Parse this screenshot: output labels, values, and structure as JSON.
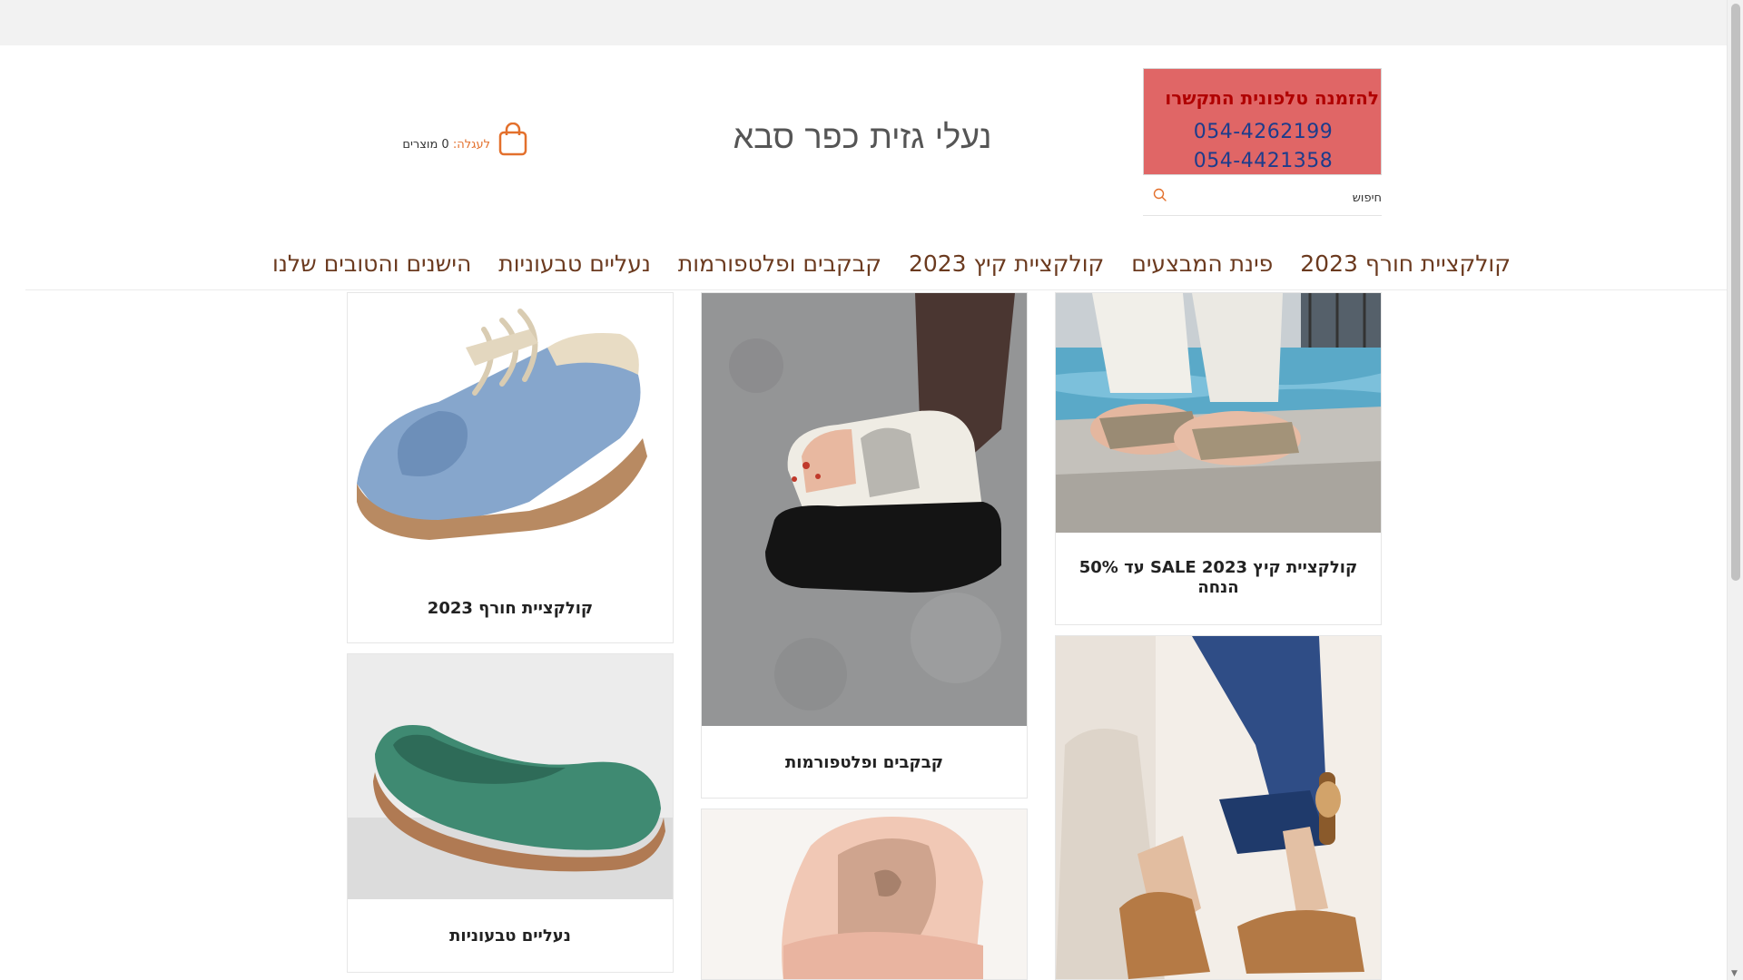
{
  "header": {
    "site_title": "נעלי גזית כפר סבא",
    "phone_banner": {
      "heading": "להזמנה טלפונית התקשרו",
      "phone_1": "054-4262199",
      "phone_2": "054-4421358"
    },
    "search": {
      "placeholder": "חיפוש"
    },
    "cart": {
      "label": "לעגלה:",
      "count_text": " 0 מוצרים"
    }
  },
  "nav": {
    "items": [
      {
        "label": "הישנים והטובים שלנו"
      },
      {
        "label": "נעליים טבעוניות"
      },
      {
        "label": "קבקבים ופלטפורמות"
      },
      {
        "label": "קולקציית קיץ 2023"
      },
      {
        "label": "פינת המבצעים"
      },
      {
        "label": "קולקציית חורף 2023"
      }
    ]
  },
  "products": [
    {
      "caption": "קולקציית קיץ 2023 SALE עד 50% הנחה",
      "icon": "summer-sandals-photo"
    },
    {
      "caption": "קבקבים ופלטפורמות",
      "icon": "platform-sandal-photo"
    },
    {
      "caption": "קולקציית חורף 2023",
      "icon": "blue-winter-shoe-photo"
    },
    {
      "caption": "נעליים טבעוניות",
      "icon": "green-flat-shoe-photo"
    },
    {
      "caption": "",
      "icon": "pink-flat-shoe-photo"
    },
    {
      "caption": "",
      "icon": "brown-sandals-photo"
    }
  ],
  "colors": {
    "accent_orange": "#e3702c",
    "banner_red": "#e06666",
    "nav_brown": "#6b3a1f"
  }
}
